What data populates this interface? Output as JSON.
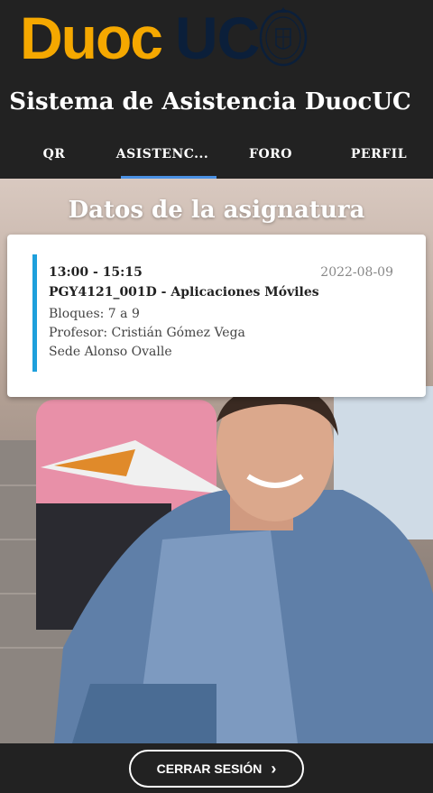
{
  "brand": {
    "part1": "Duoc",
    "part2": "UC"
  },
  "app": {
    "title": "Sistema de Asistencia DuocUC"
  },
  "tabs": [
    {
      "label": "QR"
    },
    {
      "label": "ASISTENC..."
    },
    {
      "label": "FORO"
    },
    {
      "label": "PERFIL"
    }
  ],
  "main": {
    "title": "Datos de la asignatura",
    "card": {
      "time": "13:00 - 15:15",
      "date": "2022-08-09",
      "course": "PGY4121_001D - Aplicaciones Móviles",
      "blocks": "Bloques: 7 a 9",
      "professor": "Profesor: Cristián Gómez Vega",
      "campus": "Sede Alonso Ovalle"
    }
  },
  "footer": {
    "logout_label": "CERRAR SESIÓN",
    "logout_icon": "chevron-right-icon"
  },
  "colors": {
    "header_bg": "#222222",
    "brand_yellow": "#f5a800",
    "brand_navy": "#0b1f3a",
    "accent_blue": "#1ea0dc",
    "tab_indicator": "#4a90e2"
  }
}
